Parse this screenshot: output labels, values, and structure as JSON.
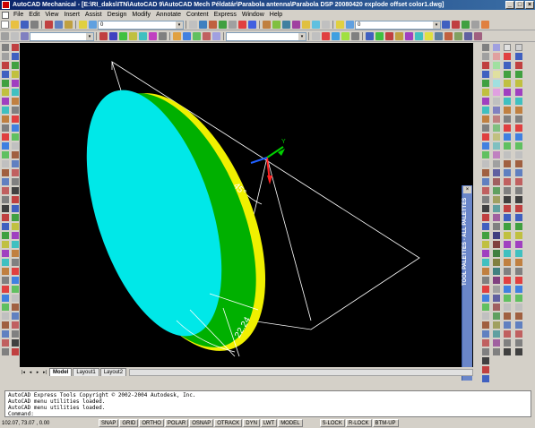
{
  "window": {
    "title": "AutoCAD Mechanical - [E:\\RI_daks\\ITN\\AutoCAD 9\\AutoCAD Mech Példatár\\Parabola antenna\\Parabola DSP 20080420 explode offset color1.dwg]",
    "minimize_glyph": "_",
    "maximize_glyph": "□",
    "close_glyph": "×"
  },
  "menu": [
    "File",
    "Edit",
    "View",
    "Insert",
    "Assist",
    "Design",
    "Modify",
    "Annotate",
    "Content",
    "Express",
    "Window",
    "Help"
  ],
  "toolbars": {
    "layer_combo_left": "0",
    "layer_combo_right": "0",
    "dropdown_glyph": "▾"
  },
  "tool_palettes_label": "TOOL PALETTES - ALL PALETTES",
  "tool_palettes_close_glyph": "×",
  "layout_tabs": {
    "nav": [
      "|◂",
      "◂",
      "▸",
      "▸|"
    ],
    "tabs": [
      "Model",
      "Layout1",
      "Layout2"
    ],
    "active": "Model"
  },
  "drawing": {
    "dimension_angle": "45°",
    "dimension_length": "22.24",
    "ucs_axis_y": "Y",
    "colors": {
      "background": "#000000",
      "dish_inner": "#00e8e8",
      "dish_rim_yellow": "#f0f000",
      "dish_rim_green": "#00b000",
      "lines": "#ffffff",
      "ucs_x": "#ff2020",
      "ucs_y": "#00d000",
      "ucs_z": "#2060ff"
    }
  },
  "command_window": {
    "lines": [
      "AutoCAD Express Tools Copyright © 2002-2004 Autodesk, Inc.",
      "AutoCAD menu utilities loaded.",
      "AutoCAD menu utilities loaded.",
      "Command:"
    ]
  },
  "status_bar": {
    "coordinates": "102.07, 73.07 , 0.00",
    "buttons": [
      "SNAP",
      "GRID",
      "ORTHO",
      "POLAR",
      "OSNAP",
      "OTRACK",
      "DYN",
      "LWT",
      "MODEL",
      "S-LOCK",
      "R-LOCK",
      "BTM-UP"
    ]
  }
}
